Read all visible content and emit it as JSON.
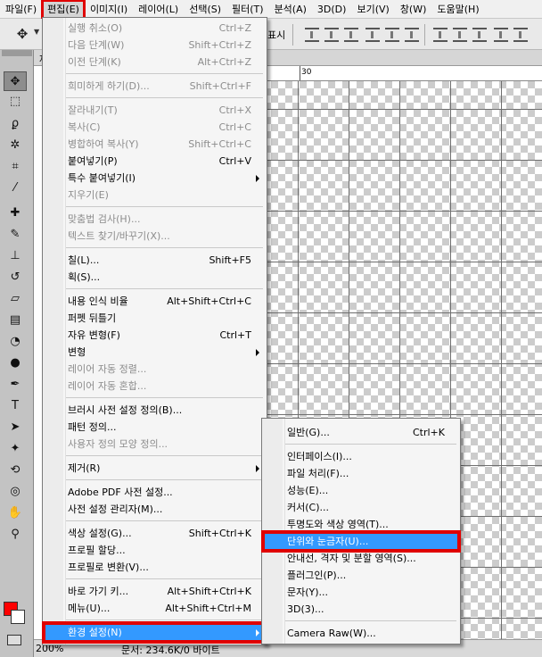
{
  "menubar": [
    "파일(F)",
    "편집(E)",
    "이미지(I)",
    "레이어(L)",
    "선택(S)",
    "필터(T)",
    "분석(A)",
    "3D(D)",
    "보기(V)",
    "창(W)",
    "도움말(H)"
  ],
  "active_menu": "편집(E)",
  "options_bar": {
    "text": "표시"
  },
  "ruler": {
    "label_30": "30"
  },
  "document_tab": {
    "label": "제"
  },
  "status": {
    "zoom": "200%",
    "doc_info": "문서: 234.6K/0 바이트"
  },
  "colors": {
    "accent_red": "#e00000",
    "highlight": "#3399ff",
    "foreground": "#ff0000",
    "background_color": "#ffffff"
  },
  "edit_menu": {
    "items": [
      {
        "label": "실행 취소(O)",
        "shortcut": "Ctrl+Z",
        "disabled": true
      },
      {
        "label": "다음 단계(W)",
        "shortcut": "Shift+Ctrl+Z",
        "disabled": true
      },
      {
        "label": "이전 단계(K)",
        "shortcut": "Alt+Ctrl+Z",
        "disabled": true
      },
      {
        "sep": true
      },
      {
        "label": "희미하게 하기(D)...",
        "shortcut": "Shift+Ctrl+F",
        "disabled": true
      },
      {
        "sep": true
      },
      {
        "label": "잘라내기(T)",
        "shortcut": "Ctrl+X",
        "disabled": true
      },
      {
        "label": "복사(C)",
        "shortcut": "Ctrl+C",
        "disabled": true
      },
      {
        "label": "병합하여 복사(Y)",
        "shortcut": "Shift+Ctrl+C",
        "disabled": true
      },
      {
        "label": "붙여넣기(P)",
        "shortcut": "Ctrl+V",
        "disabled": false
      },
      {
        "label": "특수 붙여넣기(I)",
        "shortcut": "",
        "disabled": false,
        "submenu": true
      },
      {
        "label": "지우기(E)",
        "shortcut": "",
        "disabled": true
      },
      {
        "sep": true
      },
      {
        "label": "맞춤법 검사(H)...",
        "shortcut": "",
        "disabled": true
      },
      {
        "label": "텍스트 찾기/바꾸기(X)...",
        "shortcut": "",
        "disabled": true
      },
      {
        "sep": true
      },
      {
        "label": "칠(L)...",
        "shortcut": "Shift+F5",
        "disabled": false
      },
      {
        "label": "획(S)...",
        "shortcut": "",
        "disabled": false
      },
      {
        "sep": true
      },
      {
        "label": "내용 인식 비율",
        "shortcut": "Alt+Shift+Ctrl+C",
        "disabled": false
      },
      {
        "label": "퍼펫 뒤틀기",
        "shortcut": "",
        "disabled": false
      },
      {
        "label": "자유 변형(F)",
        "shortcut": "Ctrl+T",
        "disabled": false
      },
      {
        "label": "변형",
        "shortcut": "",
        "disabled": false,
        "submenu": true
      },
      {
        "label": "레이어 자동 정렬...",
        "shortcut": "",
        "disabled": true
      },
      {
        "label": "레이어 자동 혼합...",
        "shortcut": "",
        "disabled": true
      },
      {
        "sep": true
      },
      {
        "label": "브러시 사전 설정 정의(B)...",
        "shortcut": "",
        "disabled": false
      },
      {
        "label": "패턴 정의...",
        "shortcut": "",
        "disabled": false
      },
      {
        "label": "사용자 정의 모양 정의...",
        "shortcut": "",
        "disabled": true
      },
      {
        "sep": true
      },
      {
        "label": "제거(R)",
        "shortcut": "",
        "disabled": false,
        "submenu": true
      },
      {
        "sep": true
      },
      {
        "label": "Adobe PDF 사전 설정...",
        "shortcut": "",
        "disabled": false
      },
      {
        "label": "사전 설정 관리자(M)...",
        "shortcut": "",
        "disabled": false
      },
      {
        "sep": true
      },
      {
        "label": "색상 설정(G)...",
        "shortcut": "Shift+Ctrl+K",
        "disabled": false
      },
      {
        "label": "프로필 할당...",
        "shortcut": "",
        "disabled": false
      },
      {
        "label": "프로필로 변환(V)...",
        "shortcut": "",
        "disabled": false
      },
      {
        "sep": true
      },
      {
        "label": "바로 가기 키...",
        "shortcut": "Alt+Shift+Ctrl+K",
        "disabled": false
      },
      {
        "label": "메뉴(U)...",
        "shortcut": "Alt+Shift+Ctrl+M",
        "disabled": false
      },
      {
        "sep": true
      },
      {
        "label": "환경 설정(N)",
        "shortcut": "",
        "disabled": false,
        "submenu": true,
        "highlight": true
      }
    ]
  },
  "prefs_menu": {
    "items": [
      {
        "label": "일반(G)...",
        "shortcut": "Ctrl+K"
      },
      {
        "sep": true
      },
      {
        "label": "인터페이스(I)...",
        "shortcut": ""
      },
      {
        "label": "파일 처리(F)...",
        "shortcut": ""
      },
      {
        "label": "성능(E)...",
        "shortcut": ""
      },
      {
        "label": "커서(C)...",
        "shortcut": ""
      },
      {
        "label": "투명도와 색상 영역(T)...",
        "shortcut": ""
      },
      {
        "label": "단위와 눈금자(U)...",
        "shortcut": "",
        "highlight": true
      },
      {
        "label": "안내선, 격자 및 분할 영역(S)...",
        "shortcut": ""
      },
      {
        "label": "플러그인(P)...",
        "shortcut": ""
      },
      {
        "label": "문자(Y)...",
        "shortcut": ""
      },
      {
        "label": "3D(3)...",
        "shortcut": ""
      },
      {
        "sep": true
      },
      {
        "label": "Camera Raw(W)...",
        "shortcut": ""
      }
    ]
  },
  "tools": [
    {
      "name": "move-tool-icon",
      "glyph": "✥"
    },
    {
      "name": "marquee-tool-icon",
      "glyph": "⬚"
    },
    {
      "name": "lasso-tool-icon",
      "glyph": "ϼ"
    },
    {
      "name": "quick-select-tool-icon",
      "glyph": "✲"
    },
    {
      "name": "crop-tool-icon",
      "glyph": "⌗"
    },
    {
      "name": "eyedropper-tool-icon",
      "glyph": "⁄"
    },
    {
      "name": "healing-brush-tool-icon",
      "glyph": "✚"
    },
    {
      "name": "brush-tool-icon",
      "glyph": "✎"
    },
    {
      "name": "stamp-tool-icon",
      "glyph": "⊥"
    },
    {
      "name": "history-brush-tool-icon",
      "glyph": "↺"
    },
    {
      "name": "eraser-tool-icon",
      "glyph": "▱"
    },
    {
      "name": "gradient-tool-icon",
      "glyph": "▤"
    },
    {
      "name": "blur-tool-icon",
      "glyph": "◔"
    },
    {
      "name": "dodge-tool-icon",
      "glyph": "●"
    },
    {
      "name": "pen-tool-icon",
      "glyph": "✒"
    },
    {
      "name": "type-tool-icon",
      "glyph": "T"
    },
    {
      "name": "path-select-tool-icon",
      "glyph": "➤"
    },
    {
      "name": "shape-tool-icon",
      "glyph": "✦"
    },
    {
      "name": "3d-rotate-tool-icon",
      "glyph": "⟲"
    },
    {
      "name": "3d-orbit-tool-icon",
      "glyph": "◎"
    },
    {
      "name": "hand-tool-icon",
      "glyph": "✋"
    },
    {
      "name": "zoom-tool-icon",
      "glyph": "⚲"
    }
  ]
}
